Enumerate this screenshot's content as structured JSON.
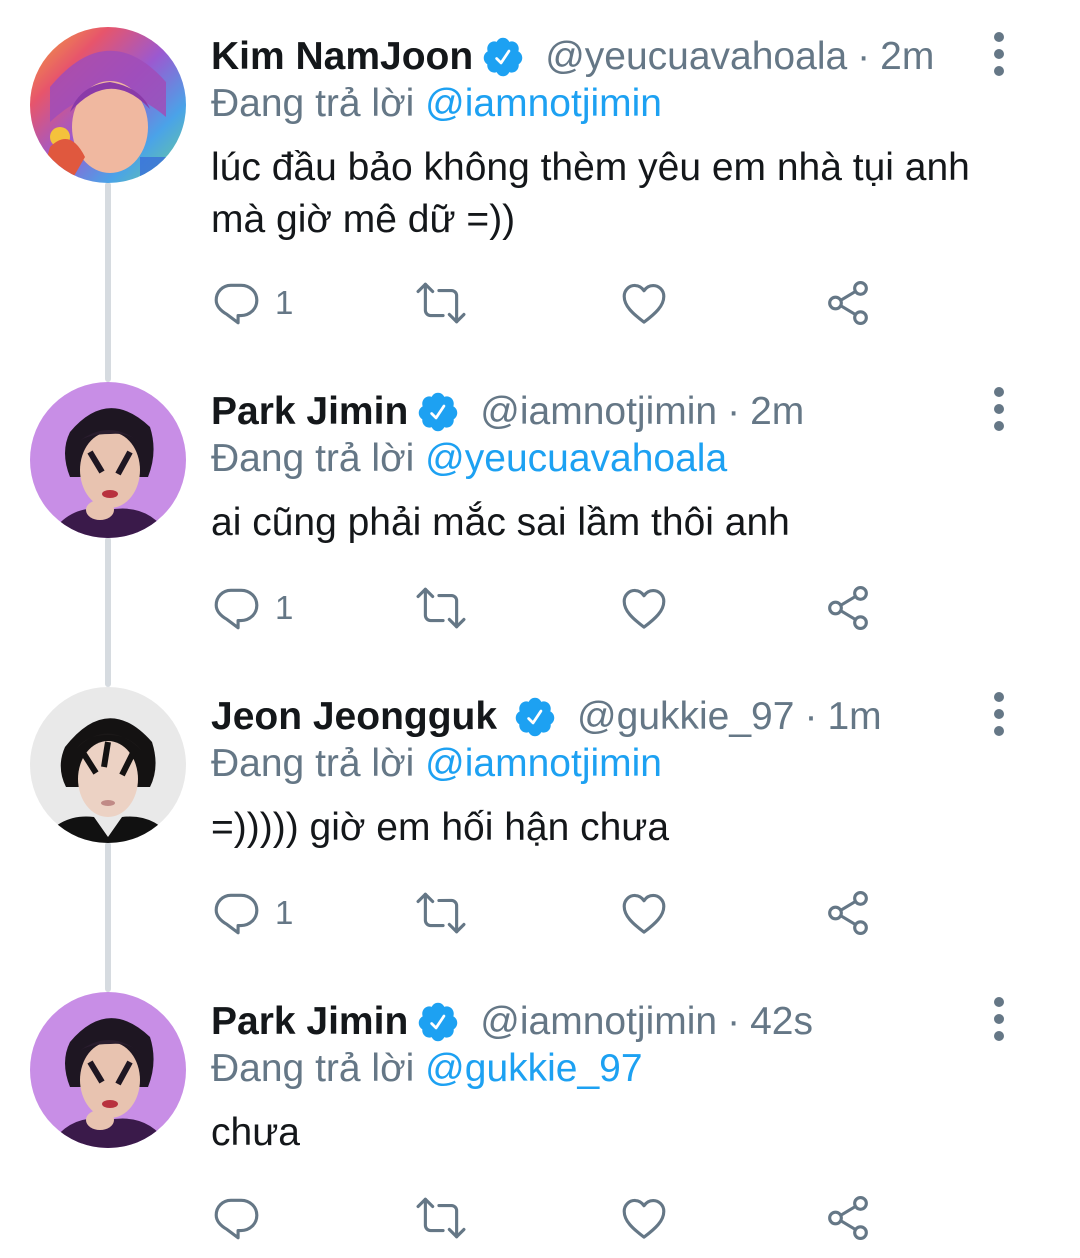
{
  "colors": {
    "accent": "#1da1f2",
    "secondary_text": "#657786",
    "primary_text": "#14171a",
    "thread_line": "#d6dbe0"
  },
  "icons": {
    "verified": "verified-badge-icon",
    "more": "more-vertical-icon",
    "reply": "reply-icon",
    "retweet": "retweet-icon",
    "like": "heart-icon",
    "share": "share-icon"
  },
  "tweets": [
    {
      "name": "Kim NamJoon",
      "handle": "@yeucuavahoala",
      "separator": "·",
      "time": "2m",
      "replying_label": "Đang trả lời",
      "replying_to": "@iamnotjimin",
      "text": "lúc đầu bảo không thèm yêu em nhà tụi anh mà giờ mê dữ =))",
      "reply_count": "1"
    },
    {
      "name": "Park Jimin",
      "handle": "@iamnotjimin",
      "separator": "·",
      "time": "2m",
      "replying_label": "Đang trả lời",
      "replying_to": "@yeucuavahoala",
      "text": "ai cũng phải mắc sai lầm thôi anh",
      "reply_count": "1"
    },
    {
      "name": "Jeon Jeongguk",
      "handle": "@gukkie_97",
      "separator": "·",
      "time": "1m",
      "replying_label": "Đang trả lời",
      "replying_to": "@iamnotjimin",
      "text": "=))))) giờ em hối hận chưa",
      "reply_count": "1"
    },
    {
      "name": "Park Jimin",
      "handle": "@iamnotjimin",
      "separator": "·",
      "time": "42s",
      "replying_label": "Đang trả lời",
      "replying_to": "@gukkie_97",
      "text": "chưa",
      "reply_count": ""
    }
  ]
}
